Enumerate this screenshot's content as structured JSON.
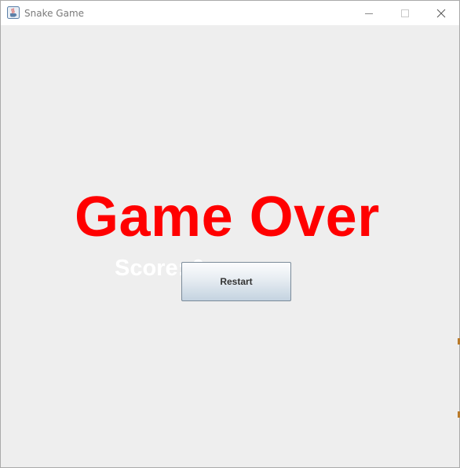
{
  "window": {
    "title": "Snake Game",
    "icon": "java-cup-icon",
    "controls": [
      "minimize-icon",
      "maximize-icon",
      "close-icon"
    ]
  },
  "game": {
    "heading": "Game Over",
    "score_text": "Score: 0",
    "restart_label": "Restart"
  },
  "colors": {
    "heading": "#ff0000",
    "score": "#ffffff",
    "background": "#eeeeee"
  }
}
